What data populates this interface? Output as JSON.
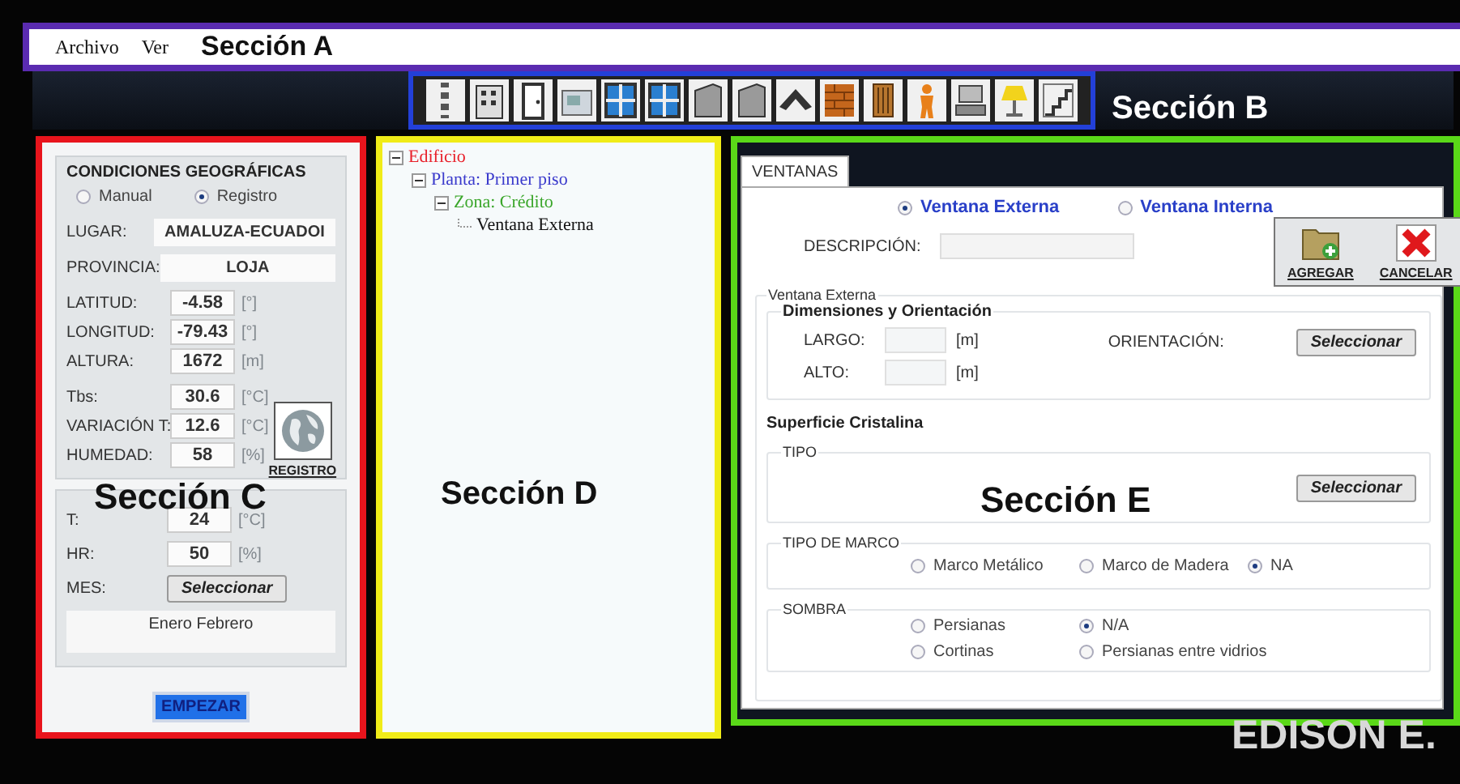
{
  "menu": [
    {
      "label": "Archivo"
    },
    {
      "label": "Ver"
    }
  ],
  "annotations": {
    "a": "Sección A",
    "b": "Sección B",
    "c": "Sección C",
    "d": "Sección D",
    "e": "Sección E",
    "credit": "EDISON E."
  },
  "geo": {
    "title": "CONDICIONES GEOGRÁFICAS",
    "modes": [
      {
        "label": "Manual",
        "selected": false
      },
      {
        "label": "Registro",
        "selected": true
      }
    ],
    "wide_fields": [
      {
        "label": "LUGAR:",
        "value": "AMALUZA-ECUADOI"
      },
      {
        "label": "PROVINCIA:",
        "value": "LOJA"
      }
    ],
    "unit_fields": [
      {
        "label": "LATITUD:",
        "value": "-4.58",
        "unit": "[°]"
      },
      {
        "label": "LONGITUD:",
        "value": "-79.43",
        "unit": "[°]"
      },
      {
        "label": "ALTURA:",
        "value": "1672",
        "unit": "[m]"
      },
      {
        "label": "Tbs:",
        "value": "30.6",
        "unit": "[°C]"
      },
      {
        "label": "VARIACIÓN T:",
        "value": "12.6",
        "unit": "[°C]"
      },
      {
        "label": "HUMEDAD:",
        "value": "58",
        "unit": "[%]"
      }
    ],
    "register_button": "REGISTRO"
  },
  "design": {
    "fields": [
      {
        "label": "T:",
        "value": "24",
        "unit": "[°C]"
      },
      {
        "label": "HR:",
        "value": "50",
        "unit": "[%]"
      }
    ],
    "month_label": "MES:",
    "month_button": "Seleccionar",
    "months": "Enero Febrero"
  },
  "start_button": "EMPEZAR",
  "tree": [
    {
      "label": "Edificio",
      "color": "#e8202a",
      "expanded": true,
      "children": [
        {
          "label": "Planta: Primer piso",
          "color": "#3a3acc",
          "expanded": true,
          "children": [
            {
              "label": "Zona: Crédito",
              "color": "#3aa62a",
              "expanded": true,
              "children": [
                {
                  "label": "Ventana Externa",
                  "color": "#111111"
                }
              ]
            }
          ]
        }
      ]
    }
  ],
  "tabs": [
    {
      "label": "VENTANAS",
      "selected": true
    }
  ],
  "window_types": [
    {
      "label": "Ventana Externa",
      "selected": true
    },
    {
      "label": "Ventana Interna",
      "selected": false
    }
  ],
  "description": {
    "label": "DESCRIPCIÓN:"
  },
  "actions": [
    {
      "label": "AGREGAR",
      "kind": "add"
    },
    {
      "label": "CANCELAR",
      "kind": "cancel"
    }
  ],
  "outer_group": "Ventana Externa",
  "dimensions": {
    "title": "Dimensiones y Orientación",
    "fields": [
      {
        "label": "LARGO:",
        "unit": "[m]"
      },
      {
        "label": "ALTO:",
        "unit": "[m]"
      }
    ],
    "orientation_label": "ORIENTACIÓN:",
    "orientation_button": "Seleccionar"
  },
  "glass": {
    "title": "Superficie Cristalina",
    "type_label": "TIPO",
    "type_button": "Seleccionar"
  },
  "frame": {
    "title": "TIPO DE MARCO",
    "options": [
      {
        "label": "Marco Metálico",
        "selected": false
      },
      {
        "label": "Marco de Madera",
        "selected": false
      },
      {
        "label": "NA",
        "selected": true
      }
    ]
  },
  "shade": {
    "title": "SOMBRA",
    "options": [
      {
        "label": "Persianas",
        "selected": false
      },
      {
        "label": "N/A",
        "selected": true
      },
      {
        "label": "Cortinas",
        "selected": false
      },
      {
        "label": "Persianas entre vidrios",
        "selected": false
      }
    ]
  }
}
